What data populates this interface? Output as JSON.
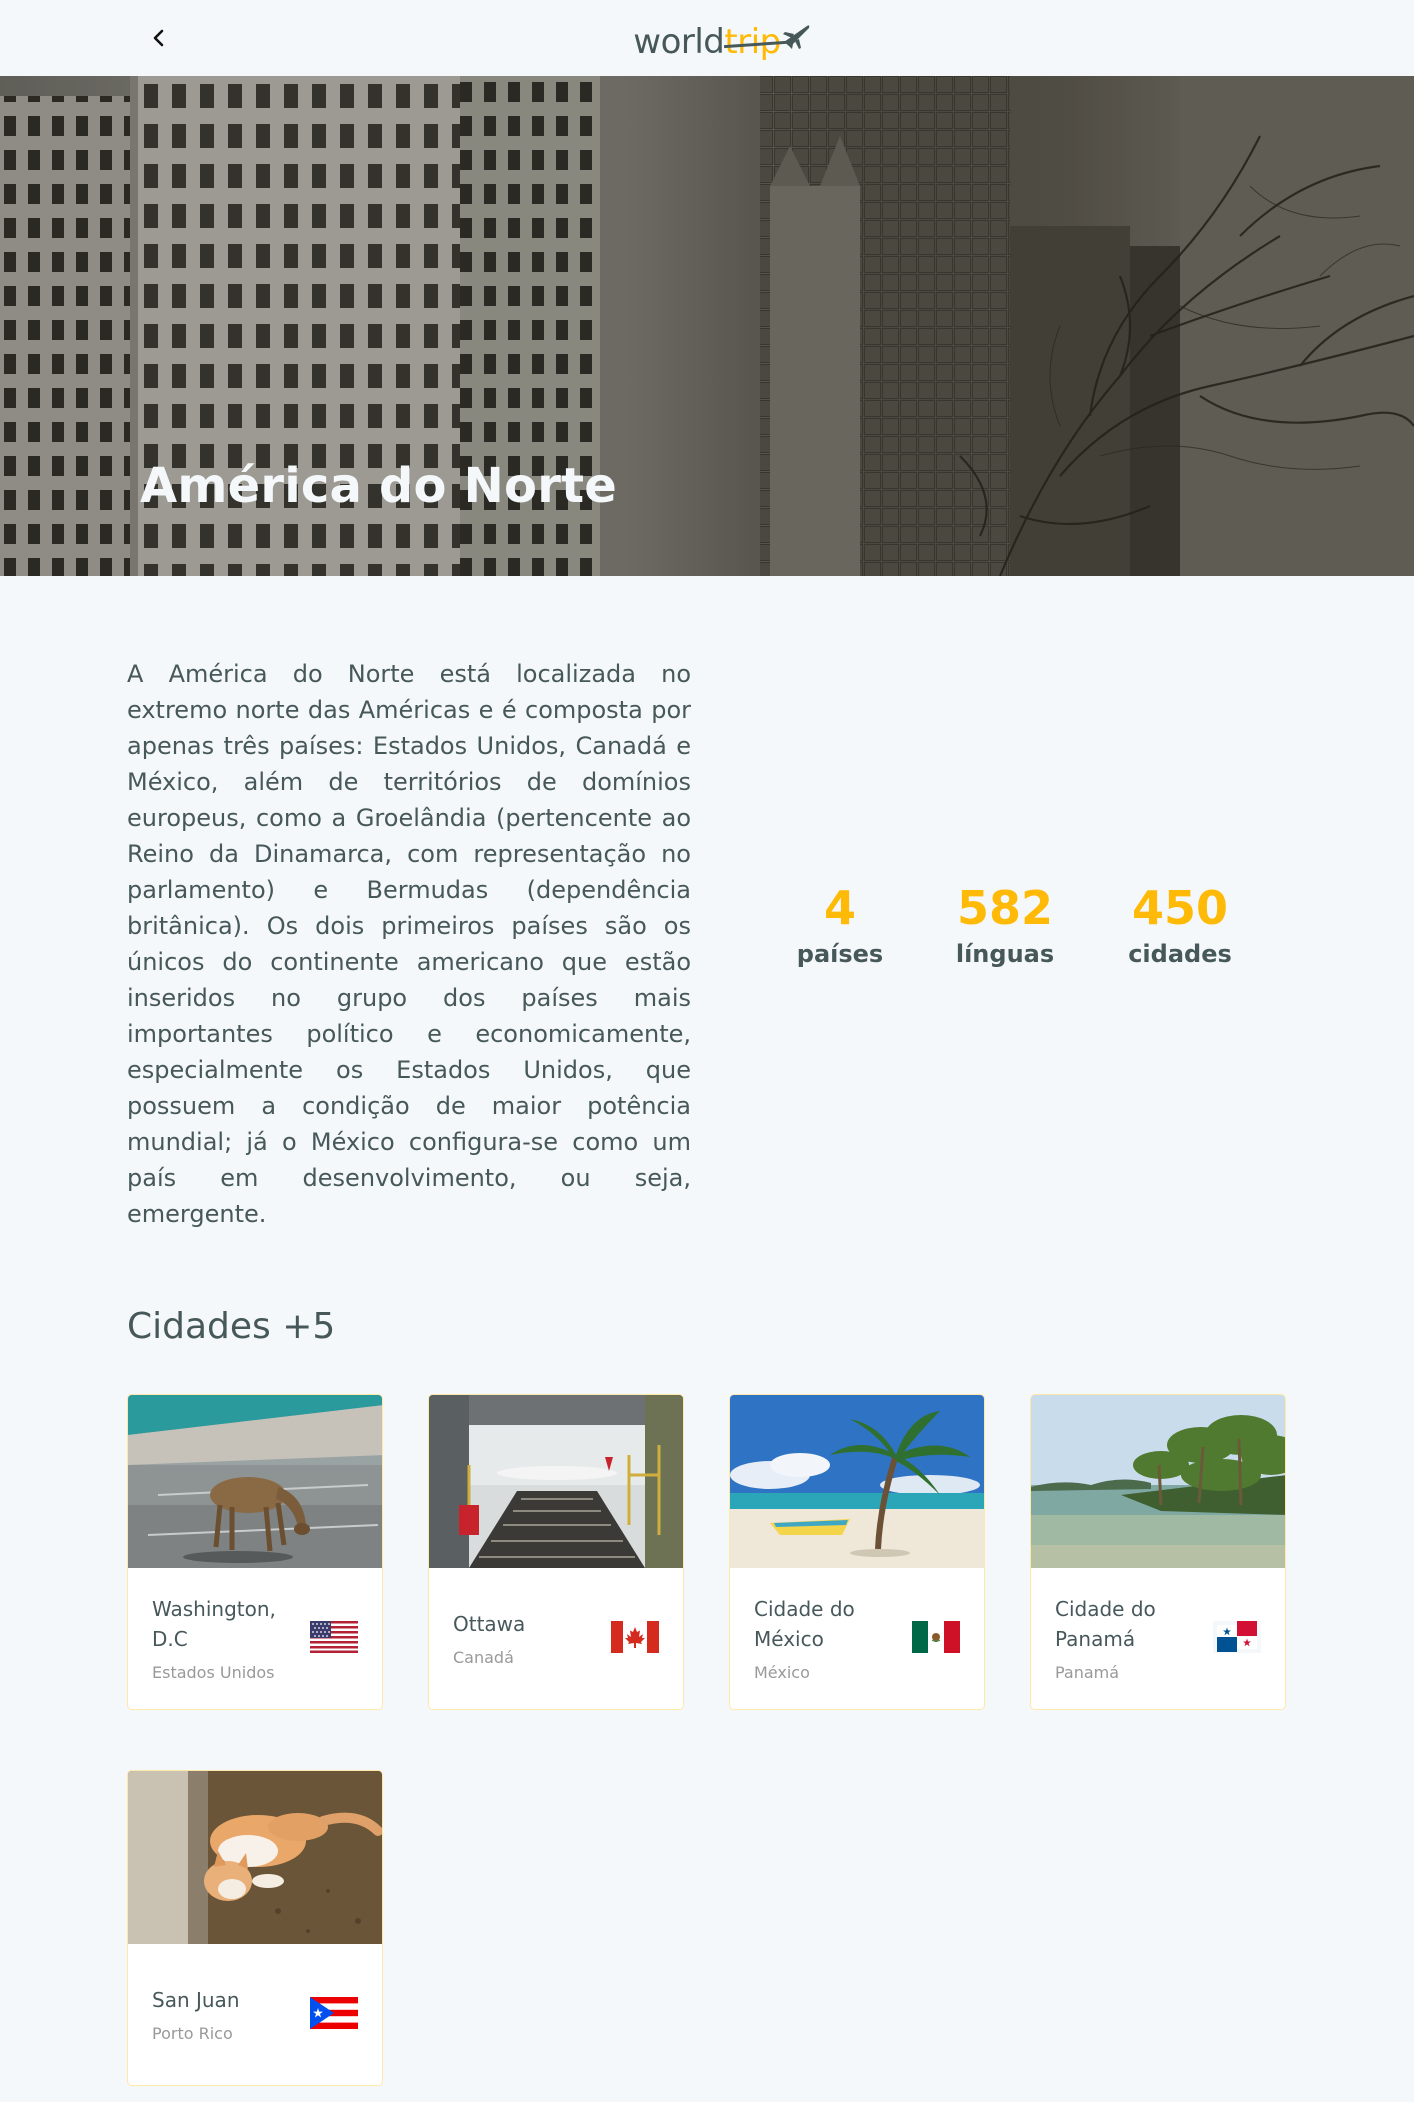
{
  "header": {
    "back_icon": "chevron-left-icon",
    "logo_part1": "world",
    "logo_part2": "trip",
    "logo_icon": "airplane-icon"
  },
  "hero": {
    "title": "América do Norte"
  },
  "continent": {
    "description": "A América do Norte está localizada no extremo norte das Américas e é composta por apenas três países: Estados Unidos, Canadá e México, além de territórios de domínios europeus, como a Groelândia (pertencente ao Reino da Dinamarca, com representação no parlamento) e Bermudas (dependência britânica). Os dois primeiros países são os únicos do continente americano que estão inseridos no grupo dos países mais importantes político e economicamente, especialmente os Estados Unidos, que possuem a condição de maior potência mundial; já o México configura-se como um país em desenvolvimento, ou seja, emergente."
  },
  "stats": [
    {
      "value": "4",
      "label": "países"
    },
    {
      "value": "582",
      "label": "línguas"
    },
    {
      "value": "450",
      "label": "cidades"
    }
  ],
  "cities_title": "Cidades +5",
  "colors": {
    "highlight": "#ffba08",
    "text": "#47585b",
    "background": "#f5f8fa",
    "card_border": "#ffe8a8"
  },
  "cities": [
    {
      "name": "Washington, D.C",
      "country": "Estados Unidos",
      "flag": "usa-flag-icon"
    },
    {
      "name": "Ottawa",
      "country": "Canadá",
      "flag": "canada-flag-icon"
    },
    {
      "name": "Cidade do México",
      "country": "México",
      "flag": "mexico-flag-icon"
    },
    {
      "name": "Cidade do Panamá",
      "country": "Panamá",
      "flag": "panama-flag-icon"
    },
    {
      "name": "San Juan",
      "country": "Porto Rico",
      "flag": "puerto-rico-flag-icon"
    }
  ]
}
